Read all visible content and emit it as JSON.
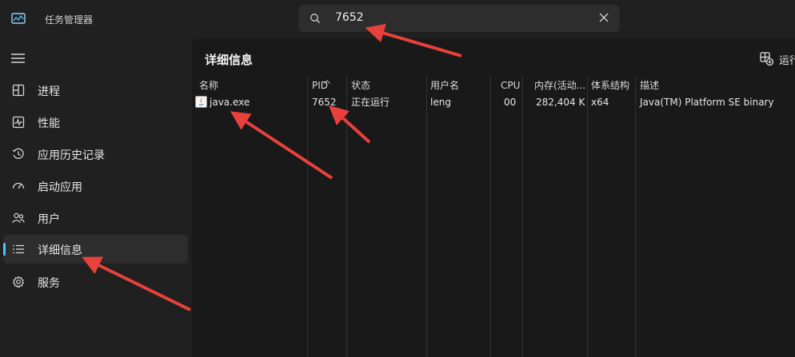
{
  "app": {
    "title": "任务管理器"
  },
  "search": {
    "value": "7652"
  },
  "sidebar": {
    "items": [
      {
        "label": "进程",
        "icon": "processes-icon"
      },
      {
        "label": "性能",
        "icon": "performance-icon"
      },
      {
        "label": "应用历史记录",
        "icon": "app-history-icon"
      },
      {
        "label": "启动应用",
        "icon": "startup-icon"
      },
      {
        "label": "用户",
        "icon": "users-icon"
      },
      {
        "label": "详细信息",
        "icon": "details-icon",
        "active": true
      },
      {
        "label": "服务",
        "icon": "services-icon"
      }
    ]
  },
  "main": {
    "title": "详细信息",
    "run_label": "运行",
    "columns": [
      "名称",
      "PID",
      "状态",
      "用户名",
      "CPU",
      "内存(活动...",
      "体系结构",
      "描述"
    ],
    "rows": [
      {
        "name": "java.exe",
        "pid": "7652",
        "status": "正在运行",
        "user": "leng",
        "cpu": "00",
        "memory": "282,404 K",
        "arch": "x64",
        "desc": "Java(TM) Platform SE binary"
      }
    ]
  },
  "colors": {
    "accent": "#4cc2ff",
    "annotation": "#e8413b",
    "background": "#202020",
    "panel": "#191919"
  }
}
